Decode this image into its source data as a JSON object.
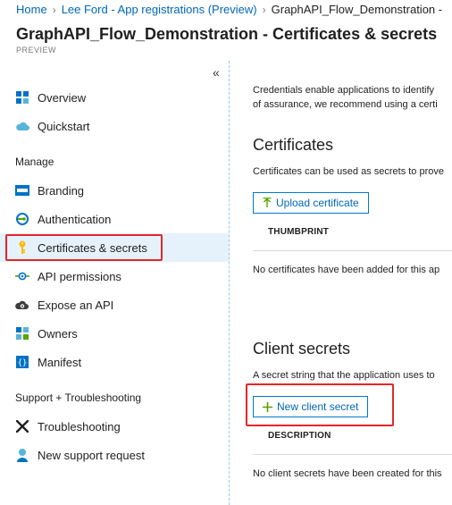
{
  "breadcrumb": {
    "items": [
      "Home",
      "Lee Ford - App registrations (Preview)",
      "GraphAPI_Flow_Demonstration -"
    ]
  },
  "page": {
    "title": "GraphAPI_Flow_Demonstration - Certificates & secrets",
    "subtitle": "PREVIEW"
  },
  "sidebar": {
    "collapse_glyph": "«",
    "items": [
      {
        "label": "Overview",
        "icon": "overview-grid-icon"
      },
      {
        "label": "Quickstart",
        "icon": "cloud-icon"
      },
      {
        "label": "Branding",
        "icon": "branding-icon"
      },
      {
        "label": "Authentication",
        "icon": "authentication-icon"
      },
      {
        "label": "Certificates & secrets",
        "icon": "key-icon"
      },
      {
        "label": "API permissions",
        "icon": "api-permissions-icon"
      },
      {
        "label": "Expose an API",
        "icon": "cloud-gear-icon"
      },
      {
        "label": "Owners",
        "icon": "owners-grid-icon"
      },
      {
        "label": "Manifest",
        "icon": "manifest-icon"
      },
      {
        "label": "Troubleshooting",
        "icon": "wrench-icon"
      },
      {
        "label": "New support request",
        "icon": "support-person-icon"
      }
    ],
    "sections": {
      "manage": "Manage",
      "support": "Support + Troubleshooting"
    },
    "active_item": "Certificates & secrets"
  },
  "main": {
    "intro_line1": "Credentials enable applications to identify",
    "intro_line2": "of assurance, we recommend using a certi",
    "certificates": {
      "heading": "Certificates",
      "description": "Certificates can be used as secrets to prove",
      "upload_button": "Upload certificate",
      "column_thumbprint": "THUMBPRINT",
      "empty_message": "No certificates have been added for this ap"
    },
    "client_secrets": {
      "heading": "Client secrets",
      "description": "A secret string that the application uses to",
      "new_button": "New client secret",
      "column_description": "DESCRIPTION",
      "empty_message": "No client secrets have been created for this"
    }
  },
  "colors": {
    "link": "#0067b8",
    "accent": "#0078d4",
    "highlight": "#e5262b",
    "active_bg": "#e6f2fb",
    "add_icon": "#57a300"
  }
}
